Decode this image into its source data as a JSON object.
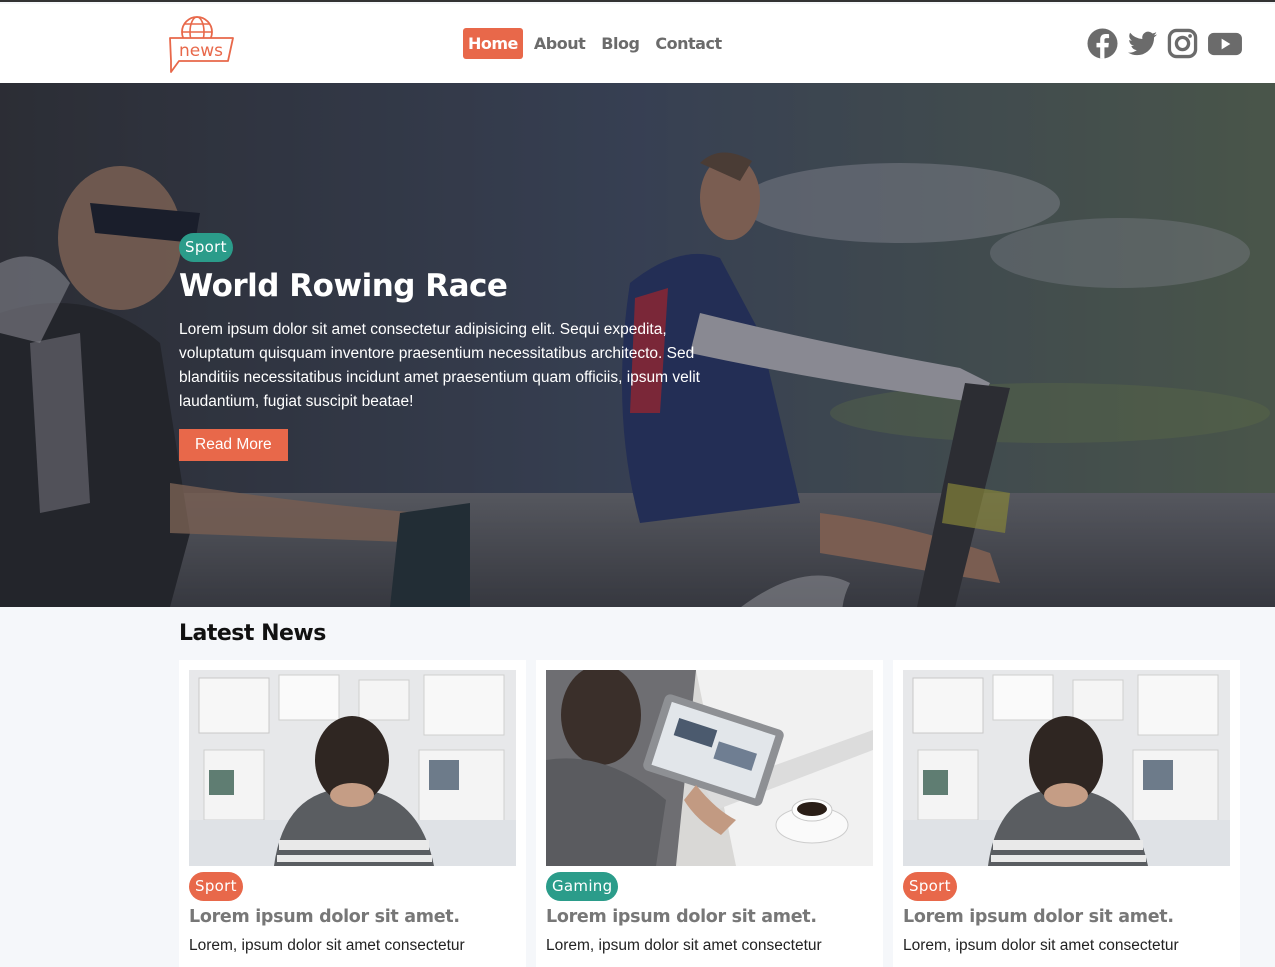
{
  "header": {
    "logo_text": "news",
    "nav": [
      {
        "label": "Home",
        "active": true
      },
      {
        "label": "About",
        "active": false
      },
      {
        "label": "Blog",
        "active": false
      },
      {
        "label": "Contact",
        "active": false
      }
    ],
    "social_icons": [
      "facebook-icon",
      "twitter-icon",
      "instagram-icon",
      "youtube-icon"
    ]
  },
  "hero": {
    "category": "Sport",
    "title": "World Rowing Race",
    "text": "Lorem ipsum dolor sit amet consectetur adipisicing elit. Sequi expedita, voluptatum quisquam inventore praesentium necessitatibus architecto. Sed blanditiis necessitatibus incidunt amet praesentium quam officiis, ipsum velit laudantium, fugiat suscipit beatae!",
    "button": "Read More"
  },
  "latest": {
    "title": "Latest News",
    "cards": [
      {
        "category": "Sport",
        "title": "Lorem ipsum dolor sit amet.",
        "text": "Lorem, ipsum dolor sit amet consectetur"
      },
      {
        "category": "Gaming",
        "title": "Lorem ipsum dolor sit amet.",
        "text": "Lorem, ipsum dolor sit amet consectetur"
      },
      {
        "category": "Sport",
        "title": "Lorem ipsum dolor sit amet.",
        "text": "Lorem, ipsum dolor sit amet consectetur"
      }
    ]
  },
  "colors": {
    "accent": "#e8684a",
    "teal": "#2b9c8a",
    "icon_gray": "#6b6b6b"
  }
}
